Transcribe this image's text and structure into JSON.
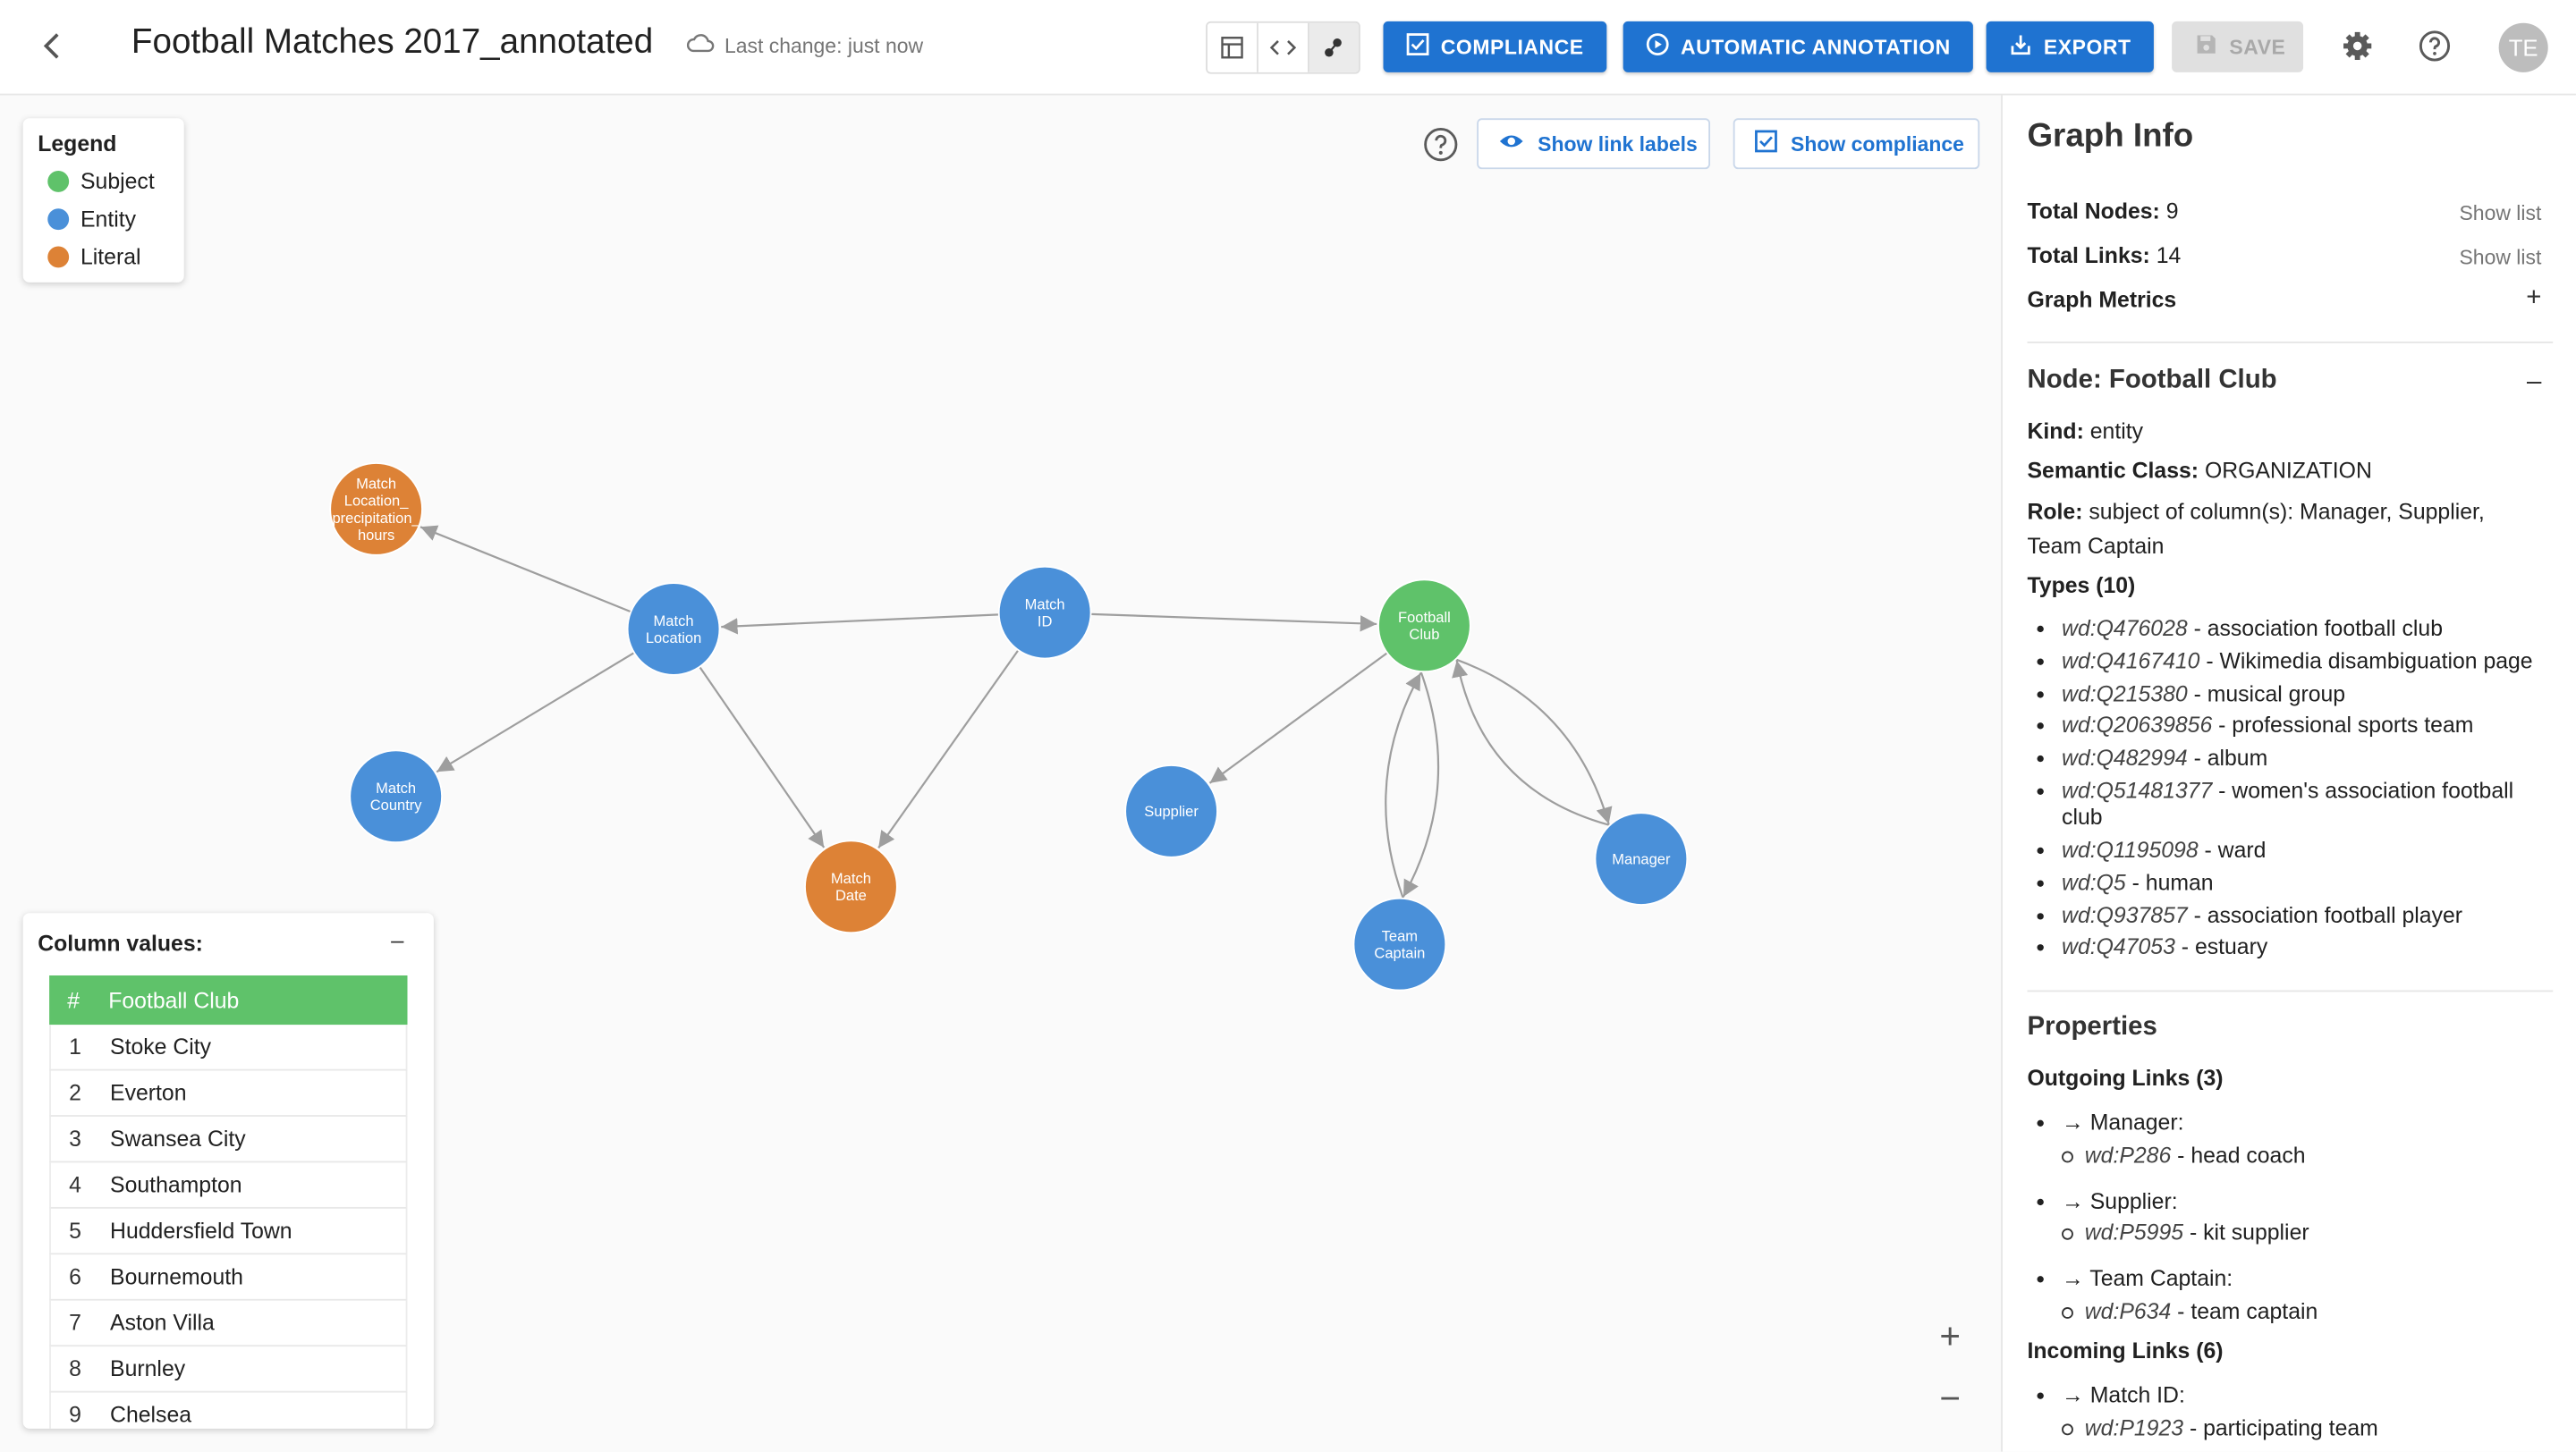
{
  "header": {
    "title": "Football Matches 2017_annotated",
    "last_change": "Last change: just now",
    "buttons": {
      "compliance": "COMPLIANCE",
      "auto": "AUTOMATIC ANNOTATION",
      "export": "EXPORT",
      "save": "SAVE"
    },
    "avatar": "TE",
    "accent": "#1f73d1"
  },
  "legend": {
    "title": "Legend",
    "items": [
      {
        "label": "Subject",
        "color": "#5fc26a"
      },
      {
        "label": "Entity",
        "color": "#4a90d9"
      },
      {
        "label": "Literal",
        "color": "#dd8236"
      }
    ]
  },
  "graph_toolbar": {
    "show_link_labels": "Show link labels",
    "show_compliance": "Show compliance"
  },
  "graph": {
    "nodes": [
      {
        "id": "loc_precip",
        "lines": [
          "Match",
          "Location_",
          "precipitation_",
          "hours"
        ],
        "kind": "literal"
      },
      {
        "id": "match_location",
        "lines": [
          "Match",
          "Location"
        ],
        "kind": "entity"
      },
      {
        "id": "match_id",
        "lines": [
          "Match",
          "ID"
        ],
        "kind": "entity"
      },
      {
        "id": "football_club",
        "lines": [
          "Football",
          "Club"
        ],
        "kind": "subject"
      },
      {
        "id": "match_country",
        "lines": [
          "Match",
          "Country"
        ],
        "kind": "entity"
      },
      {
        "id": "match_date",
        "lines": [
          "Match",
          "Date"
        ],
        "kind": "literal"
      },
      {
        "id": "supplier",
        "lines": [
          "Supplier"
        ],
        "kind": "entity"
      },
      {
        "id": "team_captain",
        "lines": [
          "Team",
          "Captain"
        ],
        "kind": "entity"
      },
      {
        "id": "manager",
        "lines": [
          "Manager"
        ],
        "kind": "entity"
      }
    ]
  },
  "columns": {
    "title": "Column values:",
    "collapse": "–",
    "header": {
      "num": "#",
      "name": "Football Club"
    },
    "rows": [
      {
        "n": "1",
        "v": "Stoke City"
      },
      {
        "n": "2",
        "v": "Everton"
      },
      {
        "n": "3",
        "v": "Swansea City"
      },
      {
        "n": "4",
        "v": "Southampton"
      },
      {
        "n": "5",
        "v": "Huddersfield Town"
      },
      {
        "n": "6",
        "v": "Bournemouth"
      },
      {
        "n": "7",
        "v": "Aston Villa"
      },
      {
        "n": "8",
        "v": "Burnley"
      },
      {
        "n": "9",
        "v": "Chelsea"
      }
    ]
  },
  "zoom": {
    "in": "+",
    "out": "−"
  },
  "info": {
    "title": "Graph Info",
    "total_nodes_label": "Total Nodes:",
    "total_nodes": "9",
    "total_links_label": "Total Links:",
    "total_links": "14",
    "show_list": "Show list",
    "metrics": "Graph Metrics",
    "metrics_toggle": "+",
    "node_title": "Node: Football Club",
    "node_toggle": "–",
    "kind_label": "Kind:",
    "kind": "entity",
    "semclass_label": "Semantic Class:",
    "semclass": "ORGANIZATION",
    "role_label": "Role:",
    "role_line1": "subject of column(s): Manager, Supplier,",
    "role_line2": "Team Captain",
    "types_title": "Types (10)",
    "types": [
      {
        "id": "wd:Q476028",
        "desc": " - association football club"
      },
      {
        "id": "wd:Q4167410",
        "desc": " - Wikimedia disambiguation page"
      },
      {
        "id": "wd:Q215380",
        "desc": " - musical group"
      },
      {
        "id": "wd:Q20639856",
        "desc": " - professional sports team"
      },
      {
        "id": "wd:Q482994",
        "desc": " - album"
      },
      {
        "id": "wd:Q51481377",
        "desc": " - women's association football",
        "desc2": "club"
      },
      {
        "id": "wd:Q1195098",
        "desc": " - ward"
      },
      {
        "id": "wd:Q5",
        "desc": " - human"
      },
      {
        "id": "wd:Q937857",
        "desc": " - association football player"
      },
      {
        "id": "wd:Q47053",
        "desc": " - estuary"
      }
    ],
    "properties": "Properties",
    "outgoing_title": "Outgoing Links (3)",
    "outgoing": [
      {
        "target": "→ Manager:",
        "prop": "wd:P286",
        "desc": " - head coach"
      },
      {
        "target": "→ Supplier:",
        "prop": "wd:P5995",
        "desc": " - kit supplier"
      },
      {
        "target": "→ Team Captain:",
        "prop": "wd:P634",
        "desc": " - team captain"
      }
    ],
    "incoming_title": "Incoming Links (6)",
    "incoming": [
      {
        "target": "→ Match ID:",
        "prop": "wd:P1923",
        "desc": " - participating team"
      }
    ]
  }
}
